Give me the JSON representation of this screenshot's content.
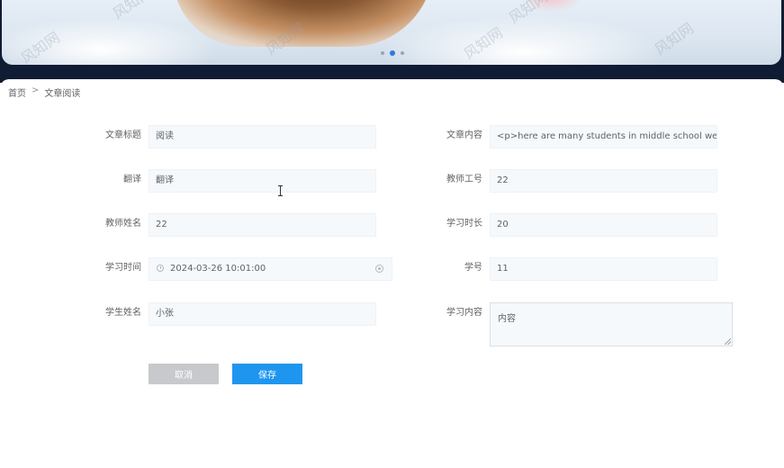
{
  "banner": {
    "watermark": "风知网",
    "slide_count": 3,
    "active_slide": 2
  },
  "breadcrumb": {
    "home": "首页",
    "separator": ">",
    "current": "文章阅读"
  },
  "form": {
    "title": {
      "label": "文章标题",
      "value": "阅读"
    },
    "content": {
      "label": "文章内容",
      "value": "<p>here are many students in middle school wear the"
    },
    "translation": {
      "label": "翻译",
      "value": "翻译"
    },
    "teacher_id": {
      "label": "教师工号",
      "value": "22"
    },
    "teacher_name": {
      "label": "教师姓名",
      "value": "22"
    },
    "study_duration": {
      "label": "学习时长",
      "value": "20"
    },
    "study_time": {
      "label": "学习时间",
      "value": "2024-03-26 10:01:00"
    },
    "student_id": {
      "label": "学号",
      "value": "11"
    },
    "student_name": {
      "label": "学生姓名",
      "value": "小张"
    },
    "study_content": {
      "label": "学习内容",
      "value": "内容"
    }
  },
  "buttons": {
    "cancel": "取消",
    "save": "保存"
  }
}
